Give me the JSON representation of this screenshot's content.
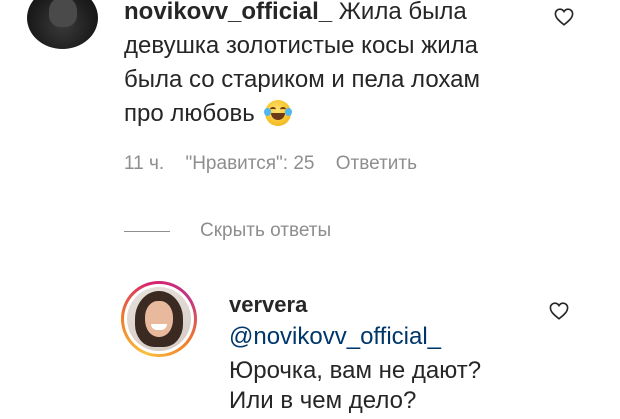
{
  "parent_comment": {
    "username": "novikovv_official_",
    "text_lines": [
      "Жила была",
      "девушка золотистые косы жила",
      "была со стариком и пела лохам",
      "про любовь"
    ],
    "emoji": "face-with-tears-of-joy",
    "time": "11 ч.",
    "likes": "\"Нравится\": 25",
    "reply_label": "Ответить"
  },
  "replies_toggle": {
    "label": "Скрыть ответы"
  },
  "reply": {
    "username": "ververa",
    "mention": "@novikovv_official_",
    "text_lines": [
      "Юрочка, вам не дают?",
      "Или в чем дело?"
    ]
  },
  "icons": {
    "like": "heart-outline-icon"
  },
  "colors": {
    "text": "#262626",
    "muted": "#8e8e8e",
    "mention": "#00376b",
    "story_ring": [
      "#f9c13f",
      "#d6246e",
      "#c13584"
    ]
  }
}
